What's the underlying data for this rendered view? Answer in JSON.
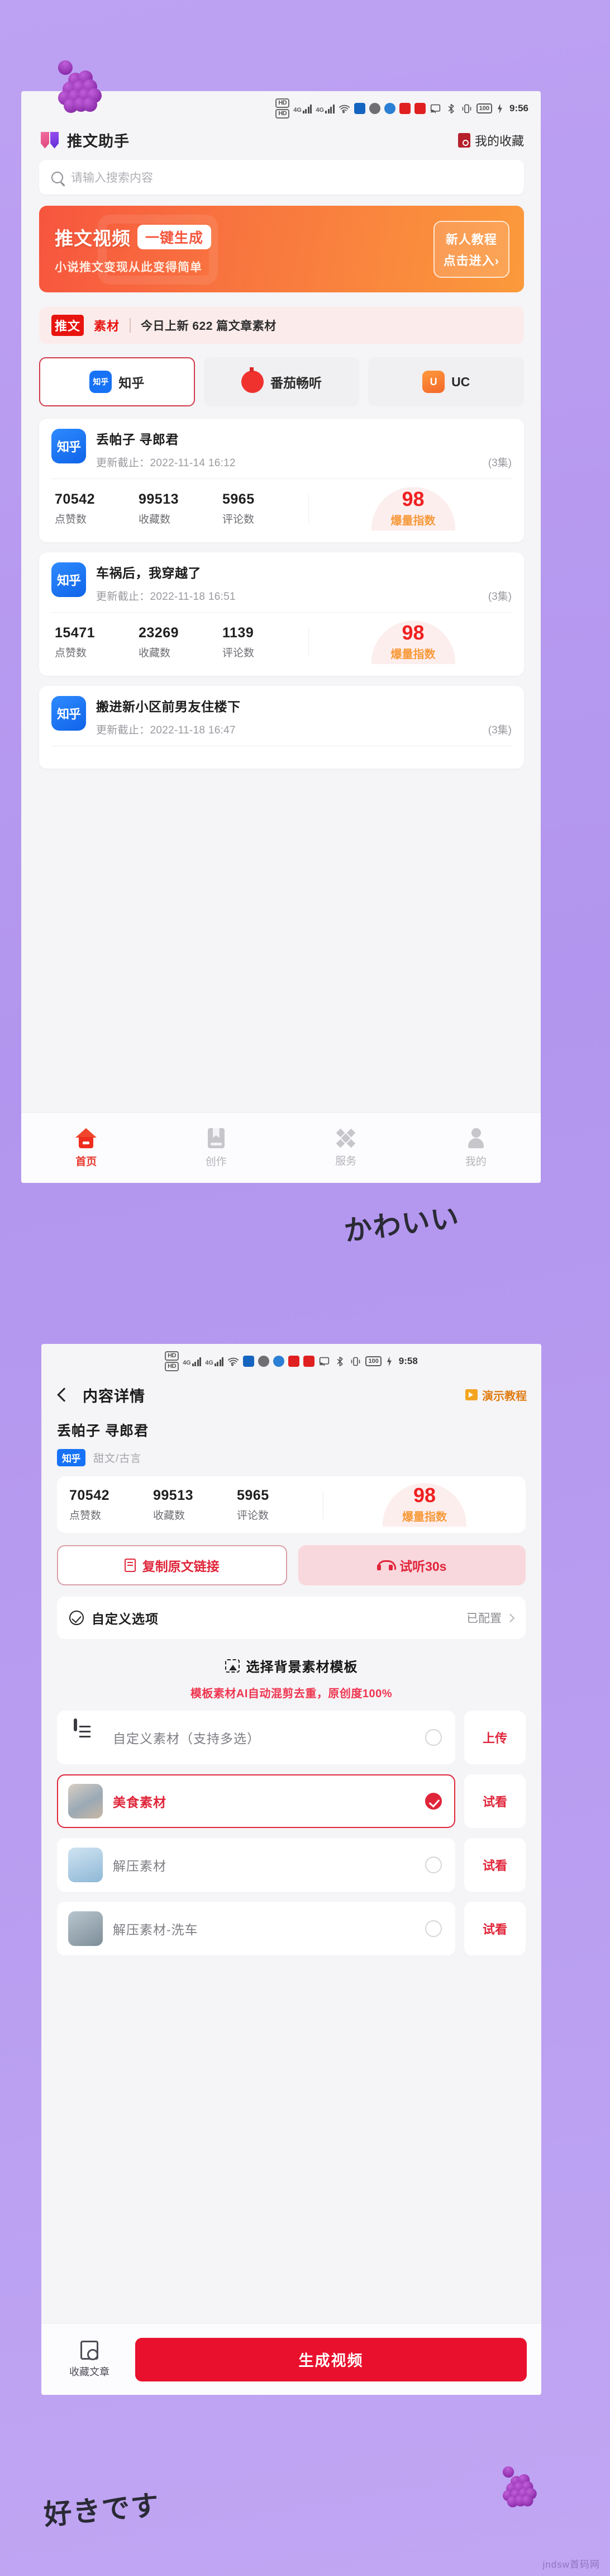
{
  "screen1": {
    "statusbar": {
      "hd1": "HD",
      "hd2": "HD",
      "net1": "4G",
      "net2": "4G",
      "battery": "100",
      "time": "9:56"
    },
    "header": {
      "app_title": "推文助手",
      "favorites_label": "我的收藏"
    },
    "search": {
      "placeholder": "请输入搜索内容"
    },
    "banner": {
      "main": "推文视频",
      "chip": "一键生成",
      "sub": "小说推文变现从此变得简单",
      "btn_line1": "新人教程",
      "btn_line2": "点击进入›"
    },
    "material_strip": {
      "badge": "推文",
      "badge2": "素材",
      "text": "今日上新 622 篇文章素材"
    },
    "source_tabs": [
      {
        "label": "知乎",
        "icon": "zhihu-icon",
        "icon_text": "知乎",
        "active": true
      },
      {
        "label": "番茄畅听",
        "icon": "tomato-icon",
        "icon_text": "",
        "active": false
      },
      {
        "label": "UC",
        "icon": "uc-icon",
        "icon_text": "U",
        "active": false
      }
    ],
    "stat_labels": {
      "likes": "点赞数",
      "favorites": "收藏数",
      "comments": "评论数"
    },
    "gauge_label": "爆量指数",
    "date_prefix": "更新截止：",
    "cards": [
      {
        "source": "知乎",
        "title": "丢帕子 寻郎君",
        "date": "更新截止：2022-11-14 16:12",
        "episodes": "(3集)",
        "likes": "70542",
        "favorites": "99513",
        "comments": "5965",
        "score": "98"
      },
      {
        "source": "知乎",
        "title": "车祸后，我穿越了",
        "date": "更新截止：2022-11-18 16:51",
        "episodes": "(3集)",
        "likes": "15471",
        "favorites": "23269",
        "comments": "1139",
        "score": "98"
      },
      {
        "source": "知乎",
        "title": "搬进新小区前男友住楼下",
        "date": "更新截止：2022-11-18 16:47",
        "episodes": "(3集)",
        "likes": "",
        "favorites": "",
        "comments": "",
        "score": ""
      }
    ],
    "tabbar": [
      {
        "label": "首页",
        "icon": "home-icon",
        "active": true
      },
      {
        "label": "创作",
        "icon": "book-icon",
        "active": false
      },
      {
        "label": "服务",
        "icon": "service-icon",
        "active": false
      },
      {
        "label": "我的",
        "icon": "person-icon",
        "active": false
      }
    ]
  },
  "screen2": {
    "statusbar": {
      "hd1": "HD",
      "hd2": "HD",
      "net1": "4G",
      "net2": "4G",
      "battery": "100",
      "time": "9:58"
    },
    "nav": {
      "title": "内容详情",
      "demo_label": "演示教程"
    },
    "detail": {
      "title": "丢帕子 寻郎君",
      "source_tag": "知乎",
      "category": "甜文/古言"
    },
    "stats": {
      "likes_value": "70542",
      "likes_label": "点赞数",
      "favorites_value": "99513",
      "favorites_label": "收藏数",
      "comments_value": "5965",
      "comments_label": "评论数",
      "score": "98",
      "score_label": "爆量指数"
    },
    "actions": {
      "copy_link": "复制原文链接",
      "preview_audio": "试听30s"
    },
    "custom_option": {
      "label": "自定义选项",
      "state": "已配置"
    },
    "template_section": {
      "title": "选择背景素材模板",
      "subtitle": "模板素材AI自动混剪去重，原创度100%"
    },
    "materials": [
      {
        "name": "自定义素材（支持多选）",
        "thumb": "doc-icon",
        "selected": false,
        "action": "上传"
      },
      {
        "name": "美食素材",
        "thumb": "food-thumb",
        "selected": true,
        "action": "试看"
      },
      {
        "name": "解压素材",
        "thumb": "relax-thumb",
        "selected": false,
        "action": "试看"
      },
      {
        "name": "解压素材-洗车",
        "thumb": "car-thumb",
        "selected": false,
        "action": "试看"
      }
    ],
    "bottombar": {
      "favorite_label": "收藏文章",
      "generate_label": "生成视频"
    }
  },
  "decorations": {
    "sticker_1": "かわいい",
    "sticker_2": "好きです",
    "watermark": "jndsw首码网"
  },
  "colors": {
    "accent_red": "#e0253a",
    "banner_orange": "#f8713f",
    "zhihu_blue": "#1772f6",
    "page_purple": "#b99cf0"
  }
}
